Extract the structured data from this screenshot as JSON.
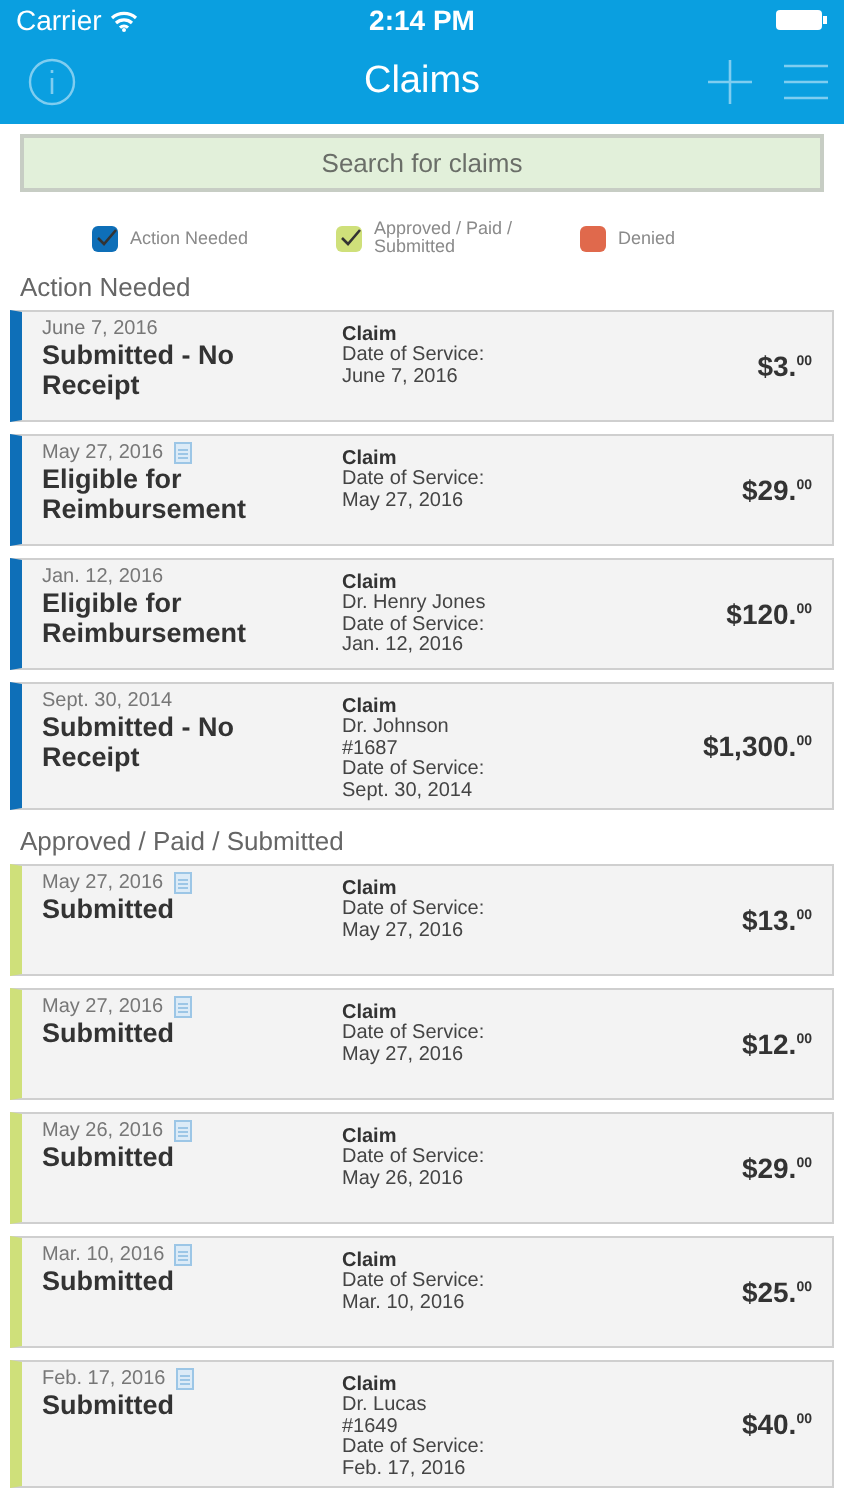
{
  "status_bar": {
    "carrier": "Carrier",
    "time": "2:14 PM"
  },
  "nav": {
    "title": "Claims"
  },
  "search": {
    "placeholder": "Search for claims"
  },
  "legend": [
    {
      "label": "Action Needed",
      "color": "#0e6fb8",
      "checked": true
    },
    {
      "label": "Approved / Paid / Submitted",
      "color": "#cfe07a",
      "checked": true
    },
    {
      "label": "Denied",
      "color": "#e0694c",
      "checked": false
    }
  ],
  "sections": [
    {
      "title": "Action Needed",
      "claims": [
        {
          "date": "June 7, 2016",
          "has_document": false,
          "status": "Submitted - No Receipt",
          "color": "#0e6fb8",
          "detail_title": "Claim",
          "lines": [
            "Date of Service:",
            "June 7, 2016"
          ],
          "amount": "$3.",
          "cents": "00"
        },
        {
          "date": "May 27, 2016",
          "has_document": true,
          "status": "Eligible for Reimbursement",
          "color": "#0e6fb8",
          "detail_title": "Claim",
          "lines": [
            "Date of Service:",
            "May 27, 2016"
          ],
          "amount": "$29.",
          "cents": "00"
        },
        {
          "date": "Jan. 12, 2016",
          "has_document": false,
          "status": "Eligible for Reimbursement",
          "color": "#0e6fb8",
          "detail_title": "Claim",
          "lines": [
            "Dr. Henry Jones",
            "Date of Service:",
            "Jan. 12, 2016"
          ],
          "amount": "$120.",
          "cents": "00"
        },
        {
          "date": "Sept. 30, 2014",
          "has_document": false,
          "status": "Submitted - No Receipt",
          "color": "#0e6fb8",
          "detail_title": "Claim",
          "lines": [
            "Dr. Johnson",
            "#1687",
            "Date of Service:",
            "Sept. 30, 2014"
          ],
          "amount": "$1,300.",
          "cents": "00"
        }
      ]
    },
    {
      "title": "Approved / Paid / Submitted",
      "claims": [
        {
          "date": "May 27, 2016",
          "has_document": true,
          "status": "Submitted",
          "color": "#cfe07a",
          "detail_title": "Claim",
          "lines": [
            "Date of Service:",
            "May 27, 2016"
          ],
          "amount": "$13.",
          "cents": "00"
        },
        {
          "date": "May 27, 2016",
          "has_document": true,
          "status": "Submitted",
          "color": "#cfe07a",
          "detail_title": "Claim",
          "lines": [
            "Date of Service:",
            "May 27, 2016"
          ],
          "amount": "$12.",
          "cents": "00"
        },
        {
          "date": "May 26, 2016",
          "has_document": true,
          "status": "Submitted",
          "color": "#cfe07a",
          "detail_title": "Claim",
          "lines": [
            "Date of Service:",
            "May 26, 2016"
          ],
          "amount": "$29.",
          "cents": "00"
        },
        {
          "date": "Mar. 10, 2016",
          "has_document": true,
          "status": "Submitted",
          "color": "#cfe07a",
          "detail_title": "Claim",
          "lines": [
            "Date of Service:",
            "Mar. 10, 2016"
          ],
          "amount": "$25.",
          "cents": "00"
        },
        {
          "date": "Feb. 17, 2016",
          "has_document": true,
          "status": "Submitted",
          "color": "#cfe07a",
          "detail_title": "Claim",
          "lines": [
            "Dr. Lucas",
            "#1649",
            "Date of Service:",
            "Feb. 17, 2016"
          ],
          "amount": "$40.",
          "cents": "00"
        }
      ]
    }
  ]
}
